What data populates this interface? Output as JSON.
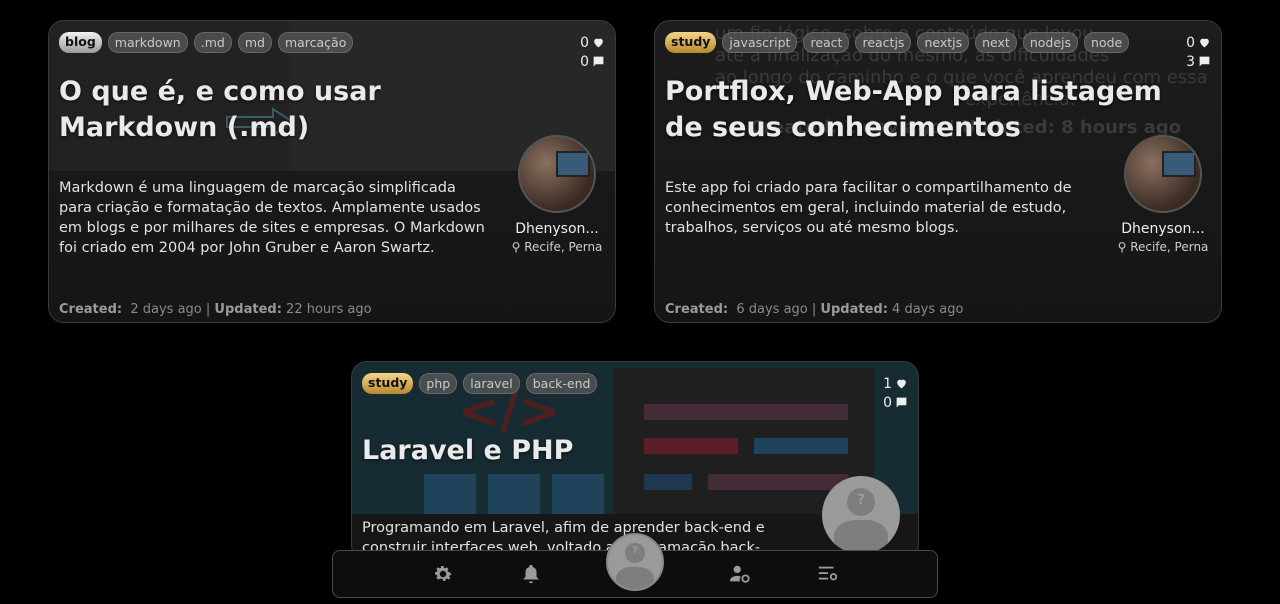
{
  "cards": [
    {
      "main_tag": "blog",
      "tags": [
        "markdown",
        ".md",
        "md",
        "marcação"
      ],
      "likes": "0",
      "comments": "0",
      "title": "O que é, e como usar Markdown (.md)",
      "description": "Markdown é uma linguagem de marcação simplificada para criação e formatação de textos. Amplamente usados em blogs e por milhares de sites e empresas. O Markdown foi criado em 2004 por John Gruber e Aaron Swartz.",
      "author_name": "Dhenyson...",
      "author_location": "Recife, Perna",
      "created_label": "Created:",
      "created": "2 days ago",
      "separator": "|",
      "updated_label": "Updated:",
      "updated": "22 hours ago"
    },
    {
      "main_tag": "study",
      "tags": [
        "javascript",
        "react",
        "reactjs",
        "nextjs",
        "next",
        "nodejs",
        "node"
      ],
      "likes": "0",
      "comments": "3",
      "title": "Portflox, Web-App para listagem de seus conhecimentos",
      "description": "Este app foi criado para facilitar o compartilhamento de conhecimentos em geral, incluindo material de estudo, trabalhos, serviços ou até mesmo blogs.",
      "author_name": "Dhenyson...",
      "author_location": "Recife, Perna",
      "created_label": "Created:",
      "created": "6 days ago",
      "separator": "|",
      "updated_label": "Updated:",
      "updated": "4 days ago",
      "background_text": [
        "um fio lógico, sobre o conteúdo que levou",
        "até a finalização do mesmo, as dificuldades",
        "ao longo do caminho e o que você aprendeu com essa",
        "experiência.",
        "Created: 1 day ago | Updated: 8 hours ago"
      ]
    },
    {
      "main_tag": "study",
      "tags": [
        "php",
        "laravel",
        "back-end"
      ],
      "likes": "1",
      "comments": "0",
      "title": "Laravel e PHP",
      "description": "Programando em Laravel, afim de aprender back-end e construir interfaces web, voltado a programação back-",
      "cover_symbol": "</>"
    }
  ],
  "navbar": {
    "items": [
      "gear-icon",
      "bell-icon",
      "avatar",
      "user-gear-icon",
      "settings-list-icon"
    ]
  },
  "colors": {
    "background": "#000000",
    "card_border": "#3a3a3a",
    "blog_tag": "#d0d0d0",
    "study_tag": "#e0b850"
  }
}
